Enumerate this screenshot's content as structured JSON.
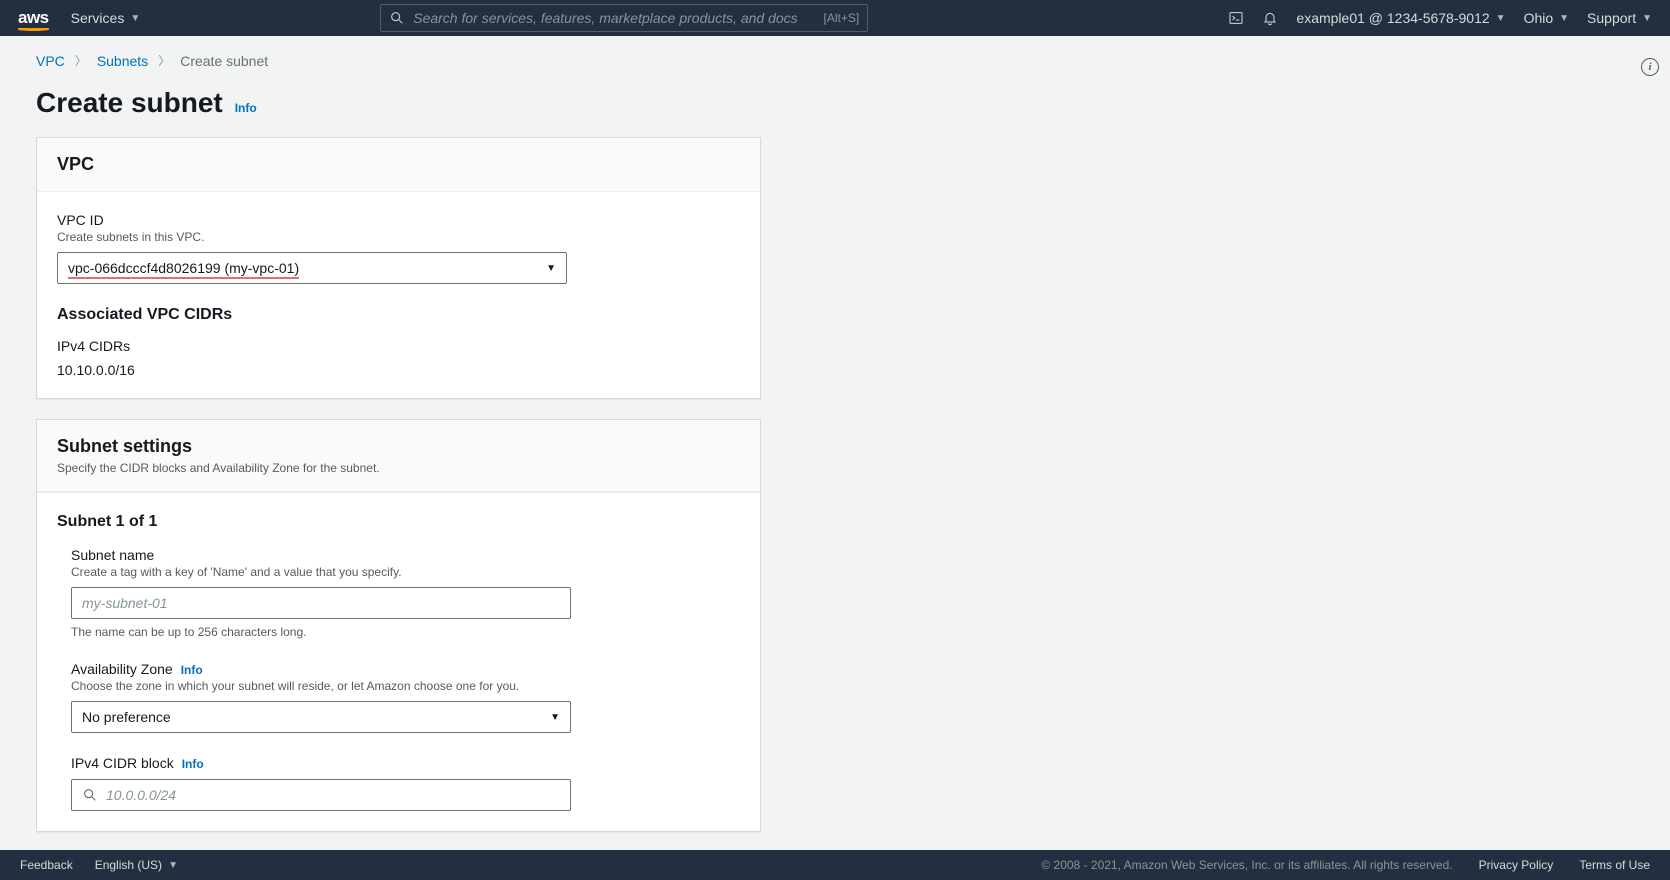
{
  "nav": {
    "logo": "aws",
    "services": "Services",
    "search_placeholder": "Search for services, features, marketplace products, and docs",
    "search_hint": "[Alt+S]",
    "account": "example01 @ 1234-5678-9012",
    "region": "Ohio",
    "support": "Support"
  },
  "breadcrumb": {
    "vpc": "VPC",
    "subnets": "Subnets",
    "current": "Create subnet"
  },
  "page": {
    "title": "Create subnet",
    "info": "Info"
  },
  "vpc_panel": {
    "heading": "VPC",
    "vpc_id_label": "VPC ID",
    "vpc_id_desc": "Create subnets in this VPC.",
    "vpc_select_value": "vpc-066dcccf4d8026199 (my-vpc-01)",
    "assoc_heading": "Associated VPC CIDRs",
    "ipv4_label": "IPv4 CIDRs",
    "ipv4_value": "10.10.0.0/16"
  },
  "subnet_panel": {
    "heading": "Subnet settings",
    "sub": "Specify the CIDR blocks and Availability Zone for the subnet.",
    "counter": "Subnet 1 of 1",
    "name_label": "Subnet name",
    "name_desc": "Create a tag with a key of 'Name' and a value that you specify.",
    "name_placeholder": "my-subnet-01",
    "name_hint": "The name can be up to 256 characters long.",
    "az_label": "Availability Zone",
    "az_info": "Info",
    "az_desc": "Choose the zone in which your subnet will reside, or let Amazon choose one for you.",
    "az_value": "No preference",
    "cidr_label": "IPv4 CIDR block",
    "cidr_info": "Info",
    "cidr_placeholder": "10.0.0.0/24"
  },
  "footer": {
    "feedback": "Feedback",
    "lang": "English (US)",
    "copyright": "© 2008 - 2021, Amazon Web Services, Inc. or its affiliates. All rights reserved.",
    "privacy": "Privacy Policy",
    "terms": "Terms of Use"
  }
}
